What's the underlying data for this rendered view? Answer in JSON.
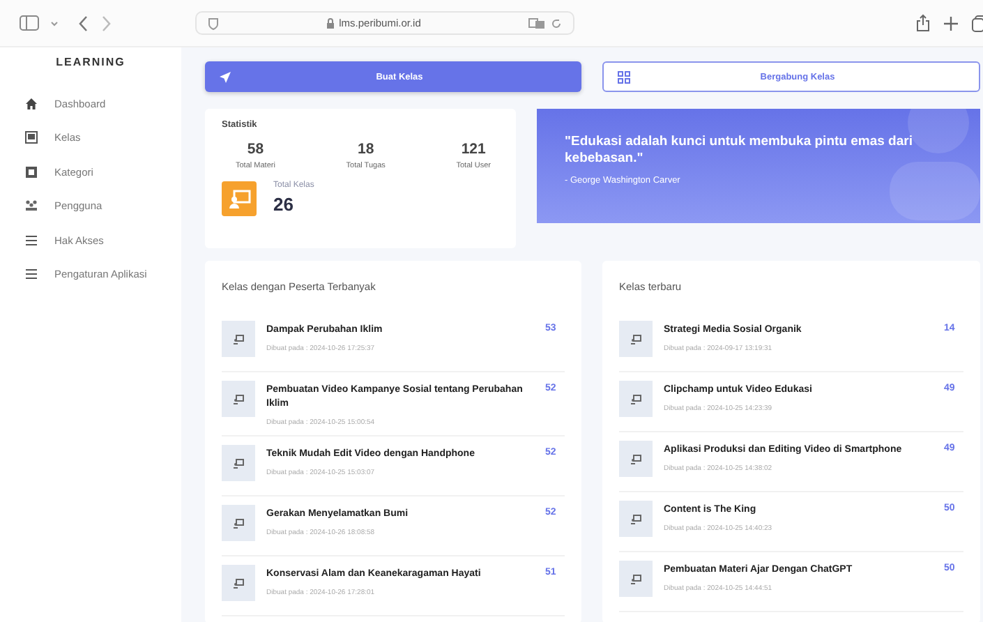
{
  "browser": {
    "url": "lms.peribumi.or.id"
  },
  "sidebar": {
    "title": "LEARNING",
    "items": [
      {
        "label": "Dashboard",
        "kind": "home"
      },
      {
        "label": "Kelas",
        "kind": "square"
      },
      {
        "label": "Kategori",
        "kind": "box"
      },
      {
        "label": "Pengguna",
        "kind": "users"
      },
      {
        "label": "Hak Akses",
        "kind": "lines"
      },
      {
        "label": "Pengaturan Aplikasi",
        "kind": "lines"
      }
    ]
  },
  "actions": [
    {
      "label": "Buat Kelas",
      "kind": "primary"
    },
    {
      "label": "Bergabung Kelas",
      "kind": "outline"
    }
  ],
  "stats": {
    "title": "Statistik",
    "items": [
      {
        "value": "58",
        "label": "Total Materi"
      },
      {
        "value": "18",
        "label": "Total Tugas"
      },
      {
        "value": "121",
        "label": "Total User"
      }
    ],
    "total": {
      "label": "Total Kelas",
      "value": "26"
    }
  },
  "quote": {
    "text": "\"Edukasi adalah kunci untuk membuka pintu emas dari kebebasan.\"",
    "author": "- George Washington Carver"
  },
  "lists": [
    {
      "title": "Kelas dengan Peserta Terbanyak",
      "rows": [
        {
          "name": "Dampak Perubahan Iklim",
          "date": "Dibuat pada : 2024-10-26 17:25:37",
          "count": "53"
        },
        {
          "name": "Pembuatan Video Kampanye Sosial tentang Perubahan Iklim",
          "date": "Dibuat pada : 2024-10-25 15:00:54",
          "count": "52"
        },
        {
          "name": "Teknik Mudah Edit Video dengan Handphone",
          "date": "Dibuat pada : 2024-10-25 15:03:07",
          "count": "52"
        },
        {
          "name": "Gerakan Menyelamatkan Bumi",
          "date": "Dibuat pada : 2024-10-26 18:08:58",
          "count": "52"
        },
        {
          "name": "Konservasi Alam dan Keanekaragaman Hayati",
          "date": "Dibuat pada : 2024-10-26 17:28:01",
          "count": "51"
        }
      ]
    },
    {
      "title": "Kelas terbaru",
      "rows": [
        {
          "name": "Strategi Media Sosial Organik",
          "date": "Dibuat pada : 2024-09-17 13:19:31",
          "count": "14"
        },
        {
          "name": "Clipchamp untuk Video Edukasi",
          "date": "Dibuat pada : 2024-10-25 14:23:39",
          "count": "49"
        },
        {
          "name": "Aplikasi Produksi dan Editing Video di Smartphone",
          "date": "Dibuat pada : 2024-10-25 14:38:02",
          "count": "49"
        },
        {
          "name": "Content is The King",
          "date": "Dibuat pada : 2024-10-25 14:40:23",
          "count": "50"
        },
        {
          "name": "Pembuatan Materi Ajar Dengan ChatGPT",
          "date": "Dibuat pada : 2024-10-25 14:44:51",
          "count": "50"
        }
      ]
    }
  ]
}
